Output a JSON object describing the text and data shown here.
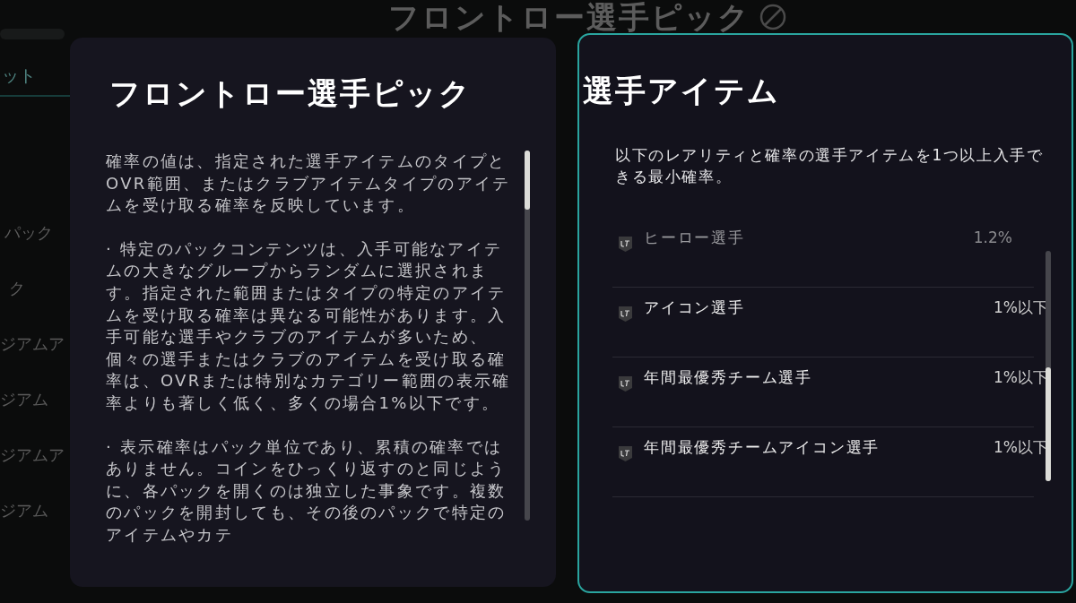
{
  "background": {
    "title": "フロントロー選手ピック",
    "tab": "ット",
    "items": [
      "パック",
      "ク",
      "ジアムア",
      "ジアム",
      "ジアムア",
      "ジアム"
    ]
  },
  "info_panel": {
    "title": "フロントロー選手ピック",
    "paragraphs": [
      "確率の値は、指定された選手アイテムのタイプとOVR範囲、またはクラブアイテムタイプのアイテムを受け取る確率を反映しています。",
      "· 特定のパックコンテンツは、入手可能なアイテムの大きなグループからランダムに選択されます。指定された範囲またはタイプの特定のアイテムを受け取る確率は異なる可能性があります。入手可能な選手やクラブのアイテムが多いため、個々の選手またはクラブのアイテムを受け取る確率は、OVRまたは特別なカテゴリー範囲の表示確率よりも著しく低く、多くの場合1%以下です。",
      "· 表示確率はパック単位であり、累積の確率ではありません。コインをひっくり返すのと同じように、各パックを開くのは独立した事象です。複数のパックを開封しても、その後のパックで特定のアイテムやカテ"
    ]
  },
  "odds_panel": {
    "title": "選手アイテム",
    "description": "以下のレアリティと確率の選手アイテムを1つ以上入手できる最小確率。",
    "rows": [
      {
        "label": "ヒーロー選手",
        "value": "1.2%",
        "faded": true
      },
      {
        "label": "アイコン選手",
        "value": "1%以下",
        "faded": false
      },
      {
        "label": "年間最優秀チーム選手",
        "value": "1%以下",
        "faded": false
      },
      {
        "label": "年間最優秀チームアイコン選手",
        "value": "1%以下",
        "faded": false
      }
    ]
  }
}
